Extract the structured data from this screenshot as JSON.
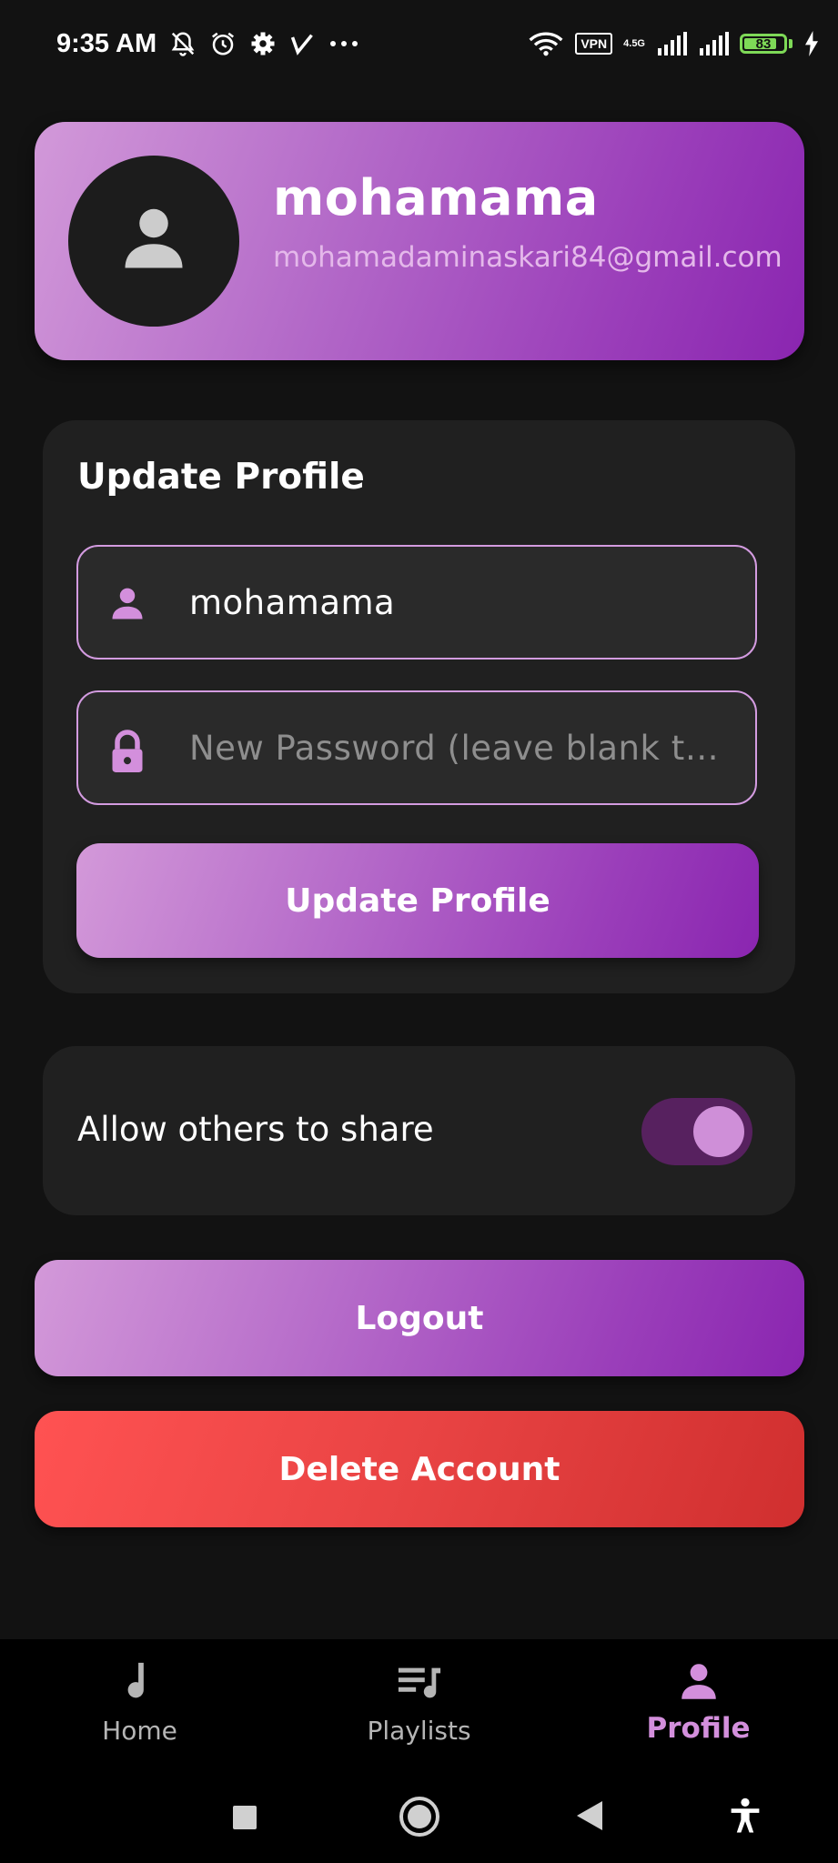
{
  "status_bar": {
    "time": "9:35 AM",
    "left_icons": [
      "muted-alarm-icon",
      "alarm-clock-icon",
      "gear-icon",
      "v-check-icon",
      "more-dots-icon"
    ],
    "right_icons": [
      "wifi-icon",
      "vpn-badge",
      "network-type",
      "signal-icon",
      "signal-icon",
      "battery-icon",
      "charging-icon"
    ],
    "vpn_label": "VPN",
    "network_type": "4.5G",
    "battery_level": "83",
    "battery_color": "#7ed957"
  },
  "profile": {
    "name": "mohamama",
    "email": "mohamadaminaskari84@gmail.com",
    "avatar_icon": "person-icon"
  },
  "update_profile": {
    "title": "Update Profile",
    "username_value": "mohamama",
    "username_icon": "person-icon",
    "password_placeholder": "New Password (leave blank t…",
    "password_icon": "lock-icon",
    "button_label": "Update Profile"
  },
  "share": {
    "label": "Allow others to share",
    "enabled": true
  },
  "actions": {
    "logout_label": "Logout",
    "delete_label": "Delete Account"
  },
  "bottom_nav": {
    "items": [
      {
        "label": "Home",
        "icon": "music-note-icon",
        "active": false
      },
      {
        "label": "Playlists",
        "icon": "playlist-icon",
        "active": false
      },
      {
        "label": "Profile",
        "icon": "person-icon",
        "active": true
      }
    ]
  },
  "system_nav": {
    "buttons": [
      "square-recents-icon",
      "circle-home-icon",
      "triangle-back-icon",
      "accessibility-icon"
    ]
  },
  "colors": {
    "accent": "#d38fdc",
    "accent_gradient_start": "#d299d9",
    "accent_gradient_end": "#8a25b0",
    "danger": "#ff5252",
    "panel_bg": "#202020",
    "page_bg": "#121212"
  }
}
